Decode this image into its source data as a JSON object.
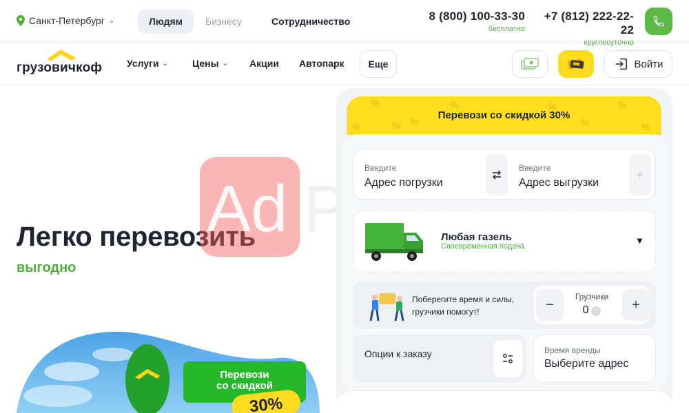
{
  "topbar": {
    "city": "Санкт-Петербург",
    "segments": [
      "Людям",
      "Бизнесу",
      "Сотрудничество"
    ],
    "phones": [
      {
        "number": "8 (800) 100-33-30",
        "note": "бесплатно"
      },
      {
        "number": "+7 (812) 222-22-22",
        "note": "круглосуточно"
      }
    ]
  },
  "nav": {
    "logo": "грузовичкоф",
    "items": [
      "Услуги",
      "Цены",
      "Акции",
      "Автопарк"
    ],
    "more": "Еще",
    "login": "Войти"
  },
  "hero": {
    "title": "Легко перевозить",
    "subtitle": "выгодно",
    "promo": {
      "line1": "Перевози",
      "line2": "со скидкой",
      "percent": "30%"
    },
    "overlay_text": "AdPlumb"
  },
  "order": {
    "banner": "Перевози со скидкой 30%",
    "from": {
      "label": "Введите",
      "value": "Адрес погрузки"
    },
    "to": {
      "label": "Введите",
      "value": "Адрес выгрузки"
    },
    "vehicle": {
      "title": "Любая газель",
      "subtitle": "Своевременная подача"
    },
    "movers": {
      "text": "Поберегите время и силы, грузчики помогут!",
      "label": "Грузчики",
      "value": "0"
    },
    "options": "Опции к заказу",
    "rent": {
      "label": "Время аренды",
      "value": "Выберите адрес"
    }
  },
  "colors": {
    "accent_green": "#5cb946",
    "accent_yellow": "#ffdc1f",
    "text_dark": "#1f2430"
  }
}
